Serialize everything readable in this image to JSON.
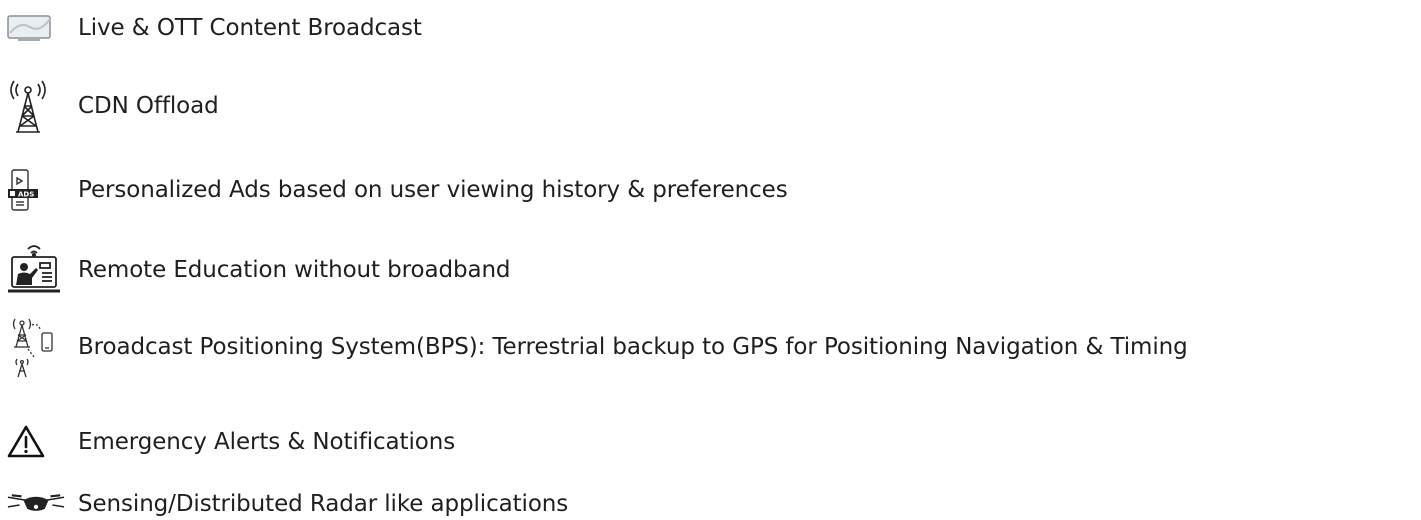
{
  "items": [
    {
      "label": "Live & OTT Content Broadcast",
      "icon": "tv-screen-icon"
    },
    {
      "label": "CDN Offload",
      "icon": "broadcast-tower-icon"
    },
    {
      "label": "Personalized Ads based on user viewing history & preferences",
      "icon": "mobile-ads-icon"
    },
    {
      "label": "Remote Education without broadband",
      "icon": "remote-teacher-icon"
    },
    {
      "label": "Broadcast Positioning System(BPS): Terrestrial backup to GPS for Positioning Navigation & Timing",
      "icon": "tower-to-phone-icon"
    },
    {
      "label": "Emergency Alerts & Notifications",
      "icon": "warning-triangle-icon"
    },
    {
      "label": "Sensing/Distributed Radar like applications",
      "icon": "drone-icon"
    }
  ],
  "colors": {
    "text": "#1f1f1f",
    "icon": "#222222",
    "background": "#ffffff"
  }
}
